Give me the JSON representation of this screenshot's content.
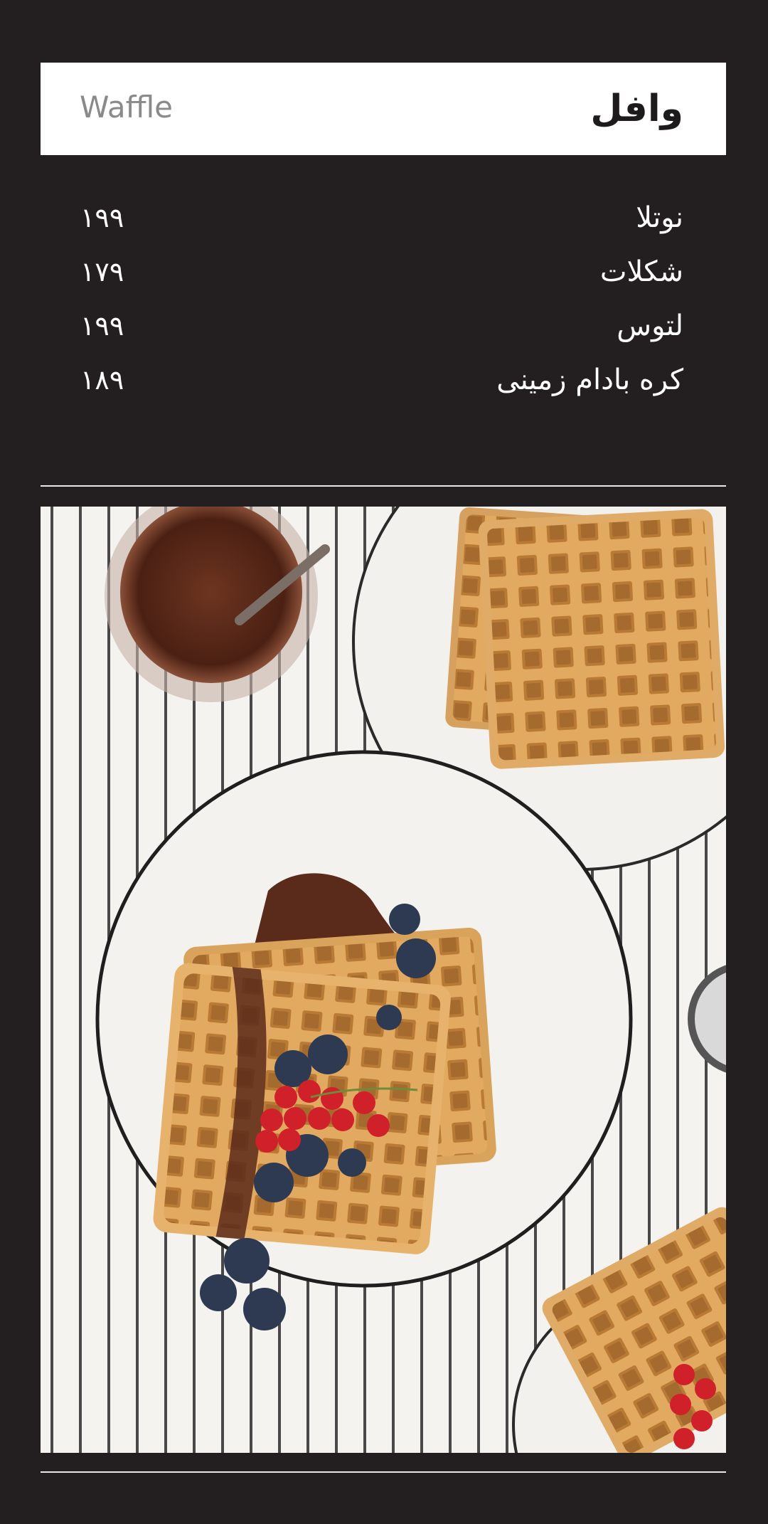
{
  "header": {
    "title_fa": "وافل",
    "title_en": "Waffle"
  },
  "menu": {
    "items": [
      {
        "name": "نوتلا",
        "price": "۱۹۹"
      },
      {
        "name": "شکلات",
        "price": "۱۷۹"
      },
      {
        "name": "لتوس",
        "price": "۱۹۹"
      },
      {
        "name": "کره بادام زمینی",
        "price": "۱۸۹"
      }
    ]
  },
  "photo": {
    "subject": "waffles-with-chocolate-sauce-and-berries"
  },
  "colors": {
    "background": "#231f20",
    "header_background": "#ffffff",
    "title_text": "#1e1b1c",
    "subtitle_text": "#8a8a8a",
    "menu_text": "#ffffff",
    "divider": "#e8e8e8",
    "waffle": "#d9a35c",
    "chocolate": "#5a2a1a"
  }
}
